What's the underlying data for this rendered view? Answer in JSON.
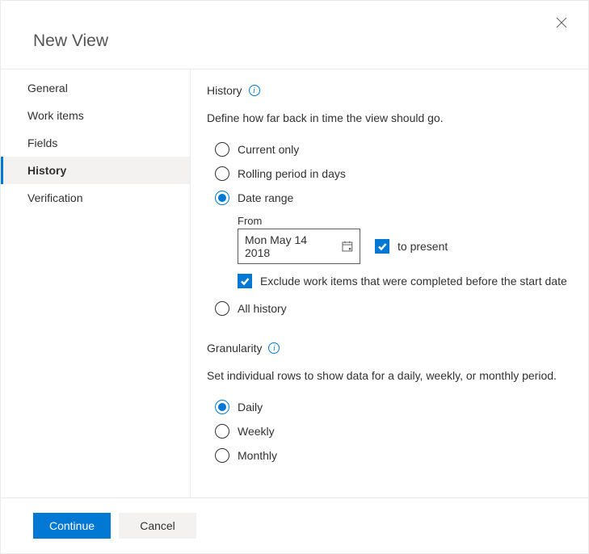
{
  "header": {
    "title": "New View"
  },
  "sidebar": {
    "items": [
      {
        "label": "General"
      },
      {
        "label": "Work items"
      },
      {
        "label": "Fields"
      },
      {
        "label": "History"
      },
      {
        "label": "Verification"
      }
    ],
    "activeIndex": 3
  },
  "history": {
    "title": "History",
    "desc": "Define how far back in time the view should go.",
    "options": {
      "current": "Current only",
      "rolling": "Rolling period in days",
      "daterange": "Date range",
      "all": "All history"
    },
    "from_label": "From",
    "from_value": "Mon May 14 2018",
    "to_present": "to present",
    "exclude": "Exclude work items that were completed before the start date"
  },
  "granularity": {
    "title": "Granularity",
    "desc": "Set individual rows to show data for a daily, weekly, or monthly period.",
    "options": {
      "daily": "Daily",
      "weekly": "Weekly",
      "monthly": "Monthly"
    }
  },
  "footer": {
    "continue": "Continue",
    "cancel": "Cancel"
  }
}
